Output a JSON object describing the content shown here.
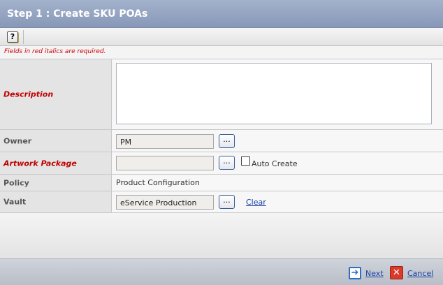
{
  "header": {
    "title": "Step 1 : Create SKU POAs"
  },
  "toolbar": {
    "help_glyph": "?"
  },
  "form": {
    "required_note": "Fields in red italics are required.",
    "description": {
      "label": "Description",
      "value": ""
    },
    "owner": {
      "label": "Owner",
      "value": "PM",
      "browse": "..."
    },
    "artwork": {
      "label": "Artwork Package",
      "value": "",
      "browse": "...",
      "auto_create_label": "Auto Create"
    },
    "policy": {
      "label": "Policy",
      "value": "Product Configuration"
    },
    "vault": {
      "label": "Vault",
      "value": "eService Production",
      "browse": "...",
      "clear": "Clear"
    }
  },
  "footer": {
    "next": "Next",
    "cancel": "Cancel",
    "next_glyph": "➜",
    "cancel_glyph": "✕"
  },
  "colors": {
    "required": "#cc0000",
    "link": "#1a3fa6",
    "title_bar": "#94a4c1"
  }
}
